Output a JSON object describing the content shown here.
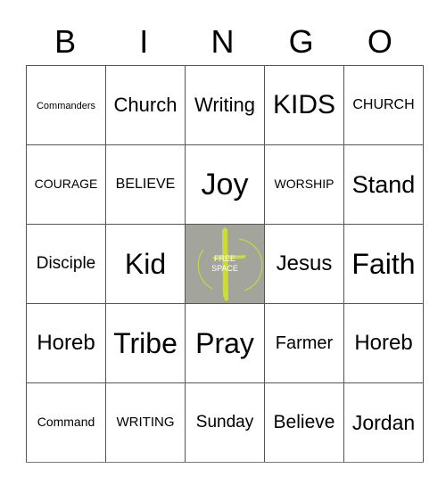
{
  "header": [
    "B",
    "I",
    "N",
    "G",
    "O"
  ],
  "board": [
    [
      {
        "text": "Commanders",
        "size": 11
      },
      {
        "text": "Church",
        "size": 22
      },
      {
        "text": "Writing",
        "size": 22
      },
      {
        "text": "KIDS",
        "size": 30
      },
      {
        "text": "CHURCH",
        "size": 16
      }
    ],
    [
      {
        "text": "COURAGE",
        "size": 14
      },
      {
        "text": "BELIEVE",
        "size": 16
      },
      {
        "text": "Joy",
        "size": 34
      },
      {
        "text": "WORSHIP",
        "size": 14
      },
      {
        "text": "Stand",
        "size": 27
      }
    ],
    [
      {
        "text": "Disciple",
        "size": 19
      },
      {
        "text": "Kid",
        "size": 32
      },
      {
        "text": "FREE SPACE",
        "free": true
      },
      {
        "text": "Jesus",
        "size": 24
      },
      {
        "text": "Faith",
        "size": 32
      }
    ],
    [
      {
        "text": "Horeb",
        "size": 24
      },
      {
        "text": "Tribe",
        "size": 32
      },
      {
        "text": "Pray",
        "size": 32
      },
      {
        "text": "Farmer",
        "size": 20
      },
      {
        "text": "Horeb",
        "size": 24
      }
    ],
    [
      {
        "text": "Command",
        "size": 14
      },
      {
        "text": "WRITING",
        "size": 15
      },
      {
        "text": "Sunday",
        "size": 19
      },
      {
        "text": "Believe",
        "size": 21
      },
      {
        "text": "Jordan",
        "size": 23
      }
    ]
  ],
  "free_space": {
    "line1": "FREE",
    "line2": "SPACE",
    "icon": "cross-circle-icon",
    "bg_color": "#a3a59c",
    "icon_color": "#cbdc3a"
  }
}
